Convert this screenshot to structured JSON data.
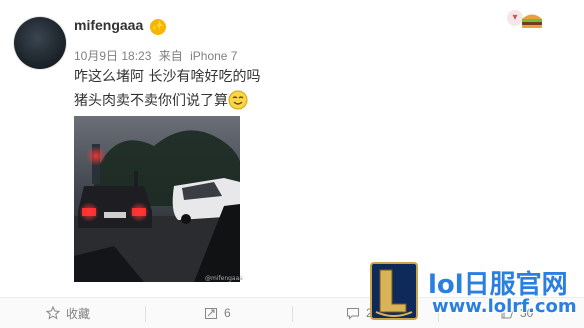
{
  "post": {
    "username": "mifengaaa",
    "badge": "✨",
    "date": "10月9日 18:23",
    "source_prefix": "来自",
    "source_device": "iPhone 7",
    "line1": "咋这么堵阿 长沙有啥好吃的吗",
    "line2": "猪头肉卖不卖你们说了算",
    "photo_watermark": "@mifengaaa"
  },
  "icons": {
    "avatar": "avatar",
    "menu": "chevron-down-icon",
    "hamburger": "burger-icon",
    "emoji": "smiley-face-icon",
    "favorite": "star-icon",
    "repost": "repost-icon",
    "comment": "comment-icon",
    "like": "like-icon"
  },
  "footer": {
    "favorite_label": "收藏",
    "repost_count": "6",
    "comment_count": "232",
    "like_count": "30"
  },
  "watermark": {
    "title": "lol日服官网",
    "url": "www.lolrf.com"
  },
  "colors": {
    "accent": "#2a7fe0",
    "badge": "#f7b500"
  }
}
